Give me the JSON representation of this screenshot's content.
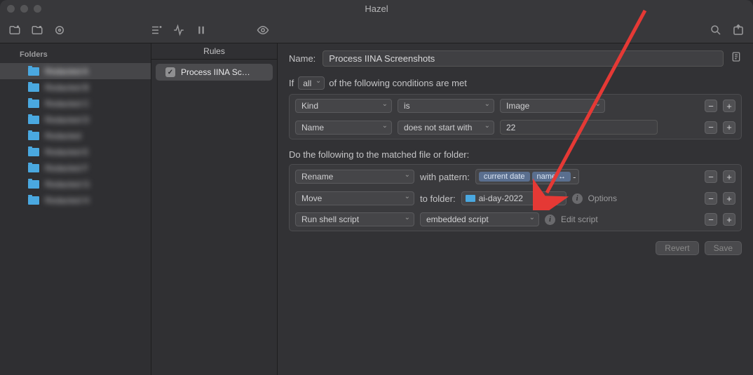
{
  "window": {
    "title": "Hazel"
  },
  "sidebar": {
    "header": "Folders",
    "items": [
      {
        "label": "Redacted A"
      },
      {
        "label": "Redacted B"
      },
      {
        "label": "Redacted C"
      },
      {
        "label": "Redacted D"
      },
      {
        "label": "Redacted"
      },
      {
        "label": "Redacted E"
      },
      {
        "label": "Redacted F"
      },
      {
        "label": "Redacted G"
      },
      {
        "label": "Redacted H"
      }
    ]
  },
  "rules": {
    "header": "Rules",
    "items": [
      {
        "label": "Process IINA Sc…"
      }
    ]
  },
  "detail": {
    "name_label": "Name:",
    "name_value": "Process IINA Screenshots",
    "if_prefix": "If",
    "if_scope": "all",
    "if_suffix": "of the following conditions are met",
    "conditions": [
      {
        "attr": "Kind",
        "op": "is",
        "value_select": "Image"
      },
      {
        "attr": "Name",
        "op": "does not start with",
        "value_text": "22"
      }
    ],
    "actions_label": "Do the following to the matched file or folder:",
    "actions": {
      "rename": {
        "verb": "Rename",
        "label": "with pattern:",
        "tokens": [
          "current date",
          "name ↔"
        ],
        "separator": "-"
      },
      "move": {
        "verb": "Move",
        "label": "to folder:",
        "folder": "ai-day-2022",
        "options_label": "Options"
      },
      "shell": {
        "verb": "Run shell script",
        "script": "embedded script",
        "edit_label": "Edit script"
      }
    },
    "buttons": {
      "revert": "Revert",
      "save": "Save"
    }
  }
}
